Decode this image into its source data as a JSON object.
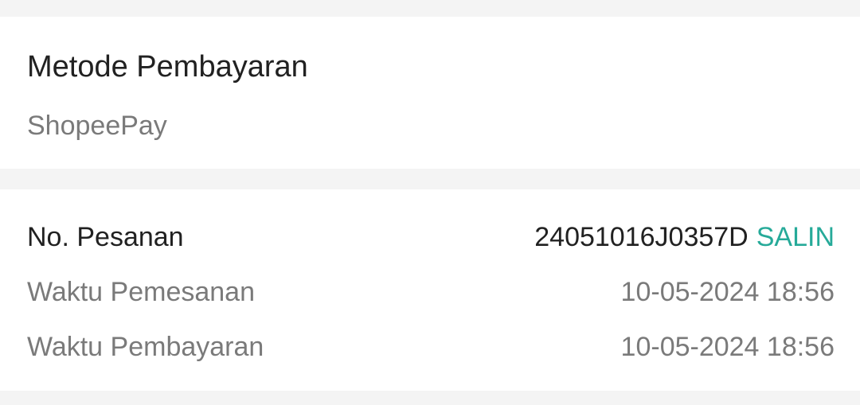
{
  "payment": {
    "title": "Metode Pembayaran",
    "method": "ShopeePay"
  },
  "order": {
    "number_label": "No. Pesanan",
    "number_value": "24051016J0357D",
    "copy_label": "SALIN",
    "order_time_label": "Waktu Pemesanan",
    "order_time_value": "10-05-2024 18:56",
    "payment_time_label": "Waktu Pembayaran",
    "payment_time_value": "10-05-2024 18:56"
  },
  "colors": {
    "background": "#f4f4f4",
    "card": "#ffffff",
    "primary_text": "#212121",
    "secondary_text": "#7a7a7a",
    "accent": "#26aa99"
  }
}
